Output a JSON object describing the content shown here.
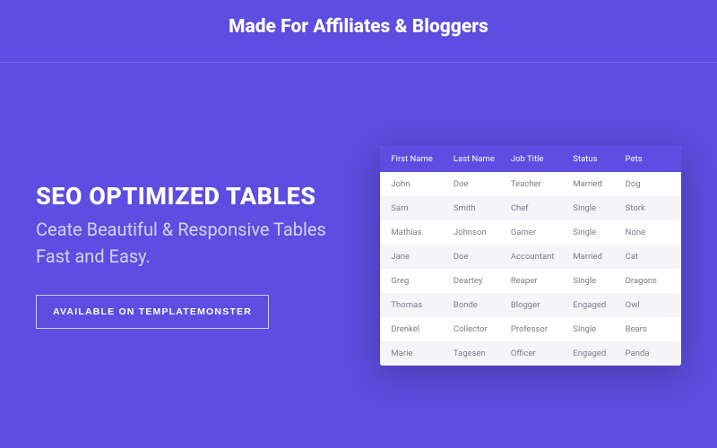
{
  "header": {
    "title": "Made For Affiliates & Bloggers"
  },
  "hero": {
    "title": "SEO OPTIMIZED TABLES",
    "subtitle": "Ceate Beautiful & Responsive Tables Fast and Easy.",
    "cta": "AVAILABLE ON TEMPLATEMONSTER"
  },
  "table": {
    "headers": [
      "First Name",
      "Last Name",
      "Job Title",
      "Status",
      "Pets"
    ],
    "rows": [
      [
        "John",
        "Doe",
        "Teacher",
        "Married",
        "Dog"
      ],
      [
        "Sam",
        "Smith",
        "Chef",
        "Single",
        "Stork"
      ],
      [
        "Mathias",
        "Johnson",
        "Gamer",
        "Single",
        "None"
      ],
      [
        "Jane",
        "Doe",
        "Accountant",
        "Married",
        "Cat"
      ],
      [
        "Greg",
        "Deartey",
        "Reaper",
        "Single",
        "Dragons"
      ],
      [
        "Thomas",
        "Bonde",
        "Blogger",
        "Engaged",
        "Owl"
      ],
      [
        "Drenkel",
        "Collector",
        "Professor",
        "Single",
        "Bears"
      ],
      [
        "Marie",
        "Tagesen",
        "Officer",
        "Engaged",
        "Panda"
      ]
    ]
  }
}
